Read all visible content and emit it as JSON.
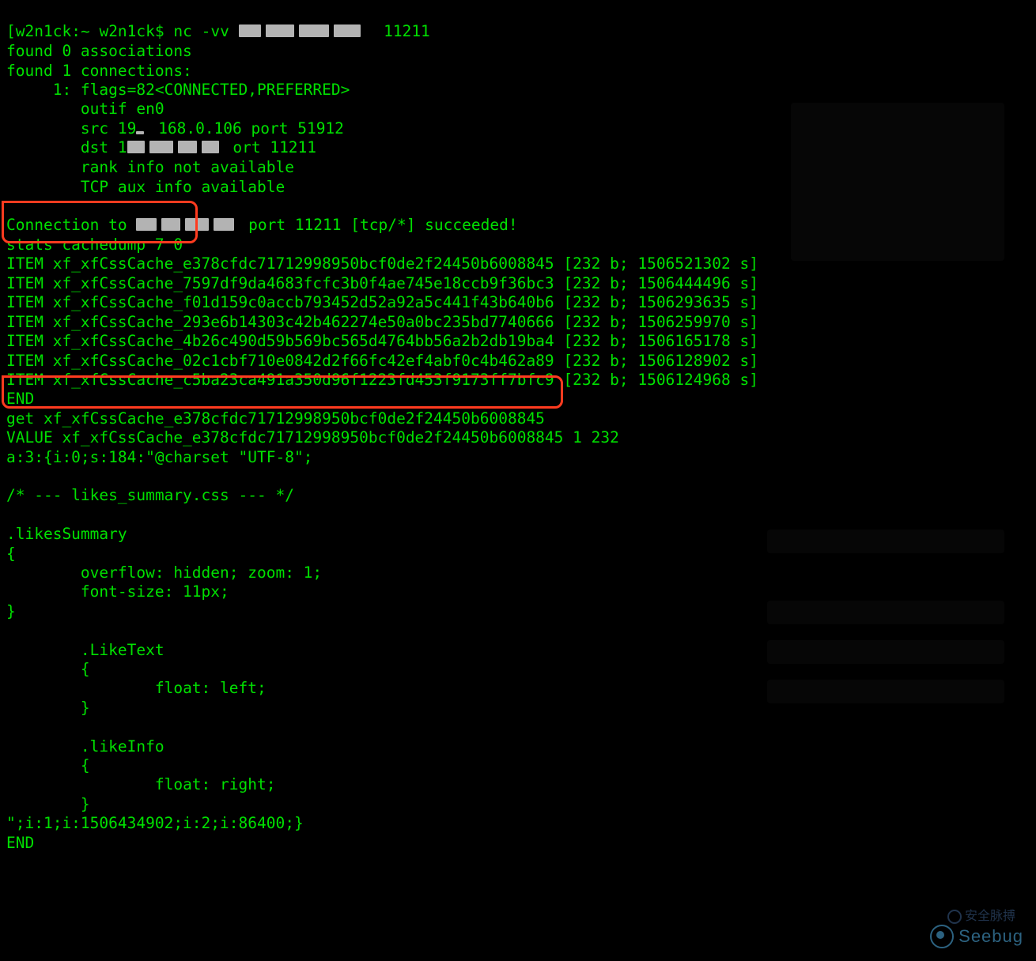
{
  "prompt": {
    "host": "w2n1ck",
    "path": "~",
    "user": "w2n1ck",
    "symbol": "$",
    "command": "nc -vv",
    "port": "11211"
  },
  "nc_output": {
    "line1": "found 0 associations",
    "line2": "found 1 connections:",
    "line3": "     1:\tflags=82<CONNECTED,PREFERRED>",
    "line4": "\toutif en0",
    "line5_prefix": "\tsrc 19",
    "line5_mid": " 168.0.106 port 51912",
    "line6_prefix": "\tdst 1",
    "line6_suffix": " ort 11211",
    "line7": "\trank info not available",
    "line8": "\tTCP aux info available",
    "conn_prefix": "Connection to ",
    "conn_suffix": " port 11211 [tcp/*] succeeded!"
  },
  "cmd1": "stats cachedump 7 0",
  "items": [
    {
      "key": "ITEM xf_xfCssCache_e378cfdc71712998950bcf0de2f24450b6008845",
      "meta": "[232 b; 1506521302 s]"
    },
    {
      "key": "ITEM xf_xfCssCache_7597df9da4683fcfc3b0f4ae745e18ccb9f36bc3",
      "meta": "[232 b; 1506444496 s]"
    },
    {
      "key": "ITEM xf_xfCssCache_f01d159c0accb793452d52a92a5c441f43b640b6",
      "meta": "[232 b; 1506293635 s]"
    },
    {
      "key": "ITEM xf_xfCssCache_293e6b14303c42b462274e50a0bc235bd7740666",
      "meta": "[232 b; 1506259970 s]"
    },
    {
      "key": "ITEM xf_xfCssCache_4b26c490d59b569bc565d4764bb56a2b2db19ba4",
      "meta": "[232 b; 1506165178 s]"
    },
    {
      "key": "ITEM xf_xfCssCache_02c1cbf710e0842d2f66fc42ef4abf0c4b462a89",
      "meta": "[232 b; 1506128902 s]"
    },
    {
      "key": "ITEM xf_xfCssCache_c5ba23ca491a350d96f1223fd453f9173ff7bfc9",
      "meta": "[232 b; 1506124968 s]"
    }
  ],
  "end1": "END",
  "cmd2": "get xf_xfCssCache_e378cfdc71712998950bcf0de2f24450b6008845",
  "value_line": "VALUE xf_xfCssCache_e378cfdc71712998950bcf0de2f24450b6008845 1 232",
  "payload_head": "a:3:{i:0;s:184:\"@charset \"UTF-8\";",
  "css_body": "\n/* --- likes_summary.css --- */\n\n.likesSummary\n{\n\toverflow: hidden; zoom: 1;\n\tfont-size: 11px;\n}\n\n\t.LikeText\n\t{\n\t\tfloat: left;\n\t}\n\n\t.likeInfo\n\t{\n\t\tfloat: right;\n\t}",
  "payload_tail": "\";i:1;i:1506434902;i:2;i:86400;}",
  "end2": "END",
  "watermarks": {
    "seebug": "Seebug",
    "cn": "安全脉搏"
  }
}
